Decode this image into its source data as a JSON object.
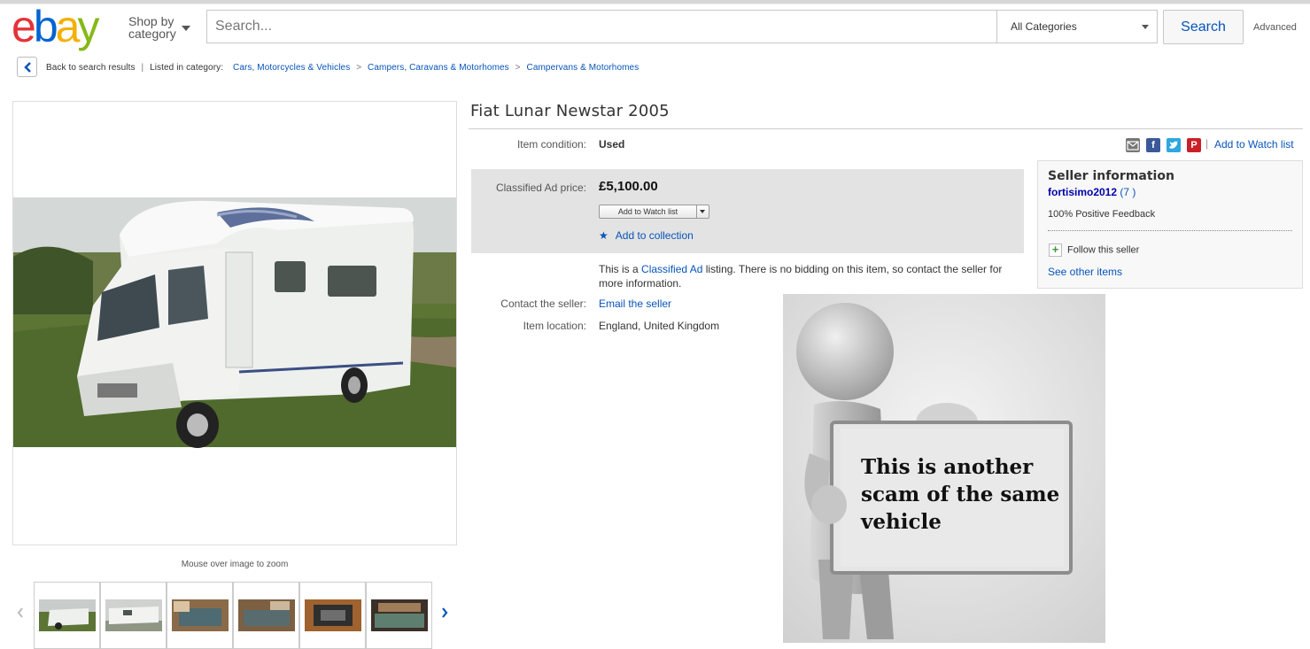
{
  "header": {
    "logo_letters": [
      "e",
      "b",
      "a",
      "y"
    ],
    "shop_by_line1": "Shop by",
    "shop_by_line2": "category",
    "search_placeholder": "Search...",
    "category_selected": "All Categories",
    "search_button": "Search",
    "advanced_link": "Advanced"
  },
  "breadcrumb": {
    "back_label": "Back to search results",
    "listed_in": "Listed in category:",
    "categories": [
      "Cars, Motorcycles & Vehicles",
      "Campers, Caravans & Motorhomes",
      "Campervans & Motorhomes"
    ]
  },
  "gallery": {
    "zoom_hint": "Mouse over image to zoom",
    "thumbnail_count": 6
  },
  "listing": {
    "title": "Fiat Lunar Newstar 2005",
    "condition_label": "Item condition:",
    "condition_value": "Used",
    "price_label": "Classified Ad price:",
    "price_value": "£5,100.00",
    "watch_button": "Add to Watch list",
    "collection_link": "Add to collection",
    "classified_text_before": "This is a",
    "classified_link": "Classified Ad",
    "classified_text_after": "listing. There is no bidding on this item, so contact the seller for more information.",
    "contact_label": "Contact the seller:",
    "contact_value": "Email the seller",
    "location_label": "Item location:",
    "location_value": "England, United Kingdom"
  },
  "share": {
    "icons": [
      "email-icon",
      "facebook-icon",
      "twitter-icon",
      "pinterest-icon"
    ],
    "watch_link": "Add to Watch list",
    "separator": "|"
  },
  "seller": {
    "heading": "Seller information",
    "username": "fortisimo2012",
    "feedback_score": "(7 )",
    "feedback_percent": "100% Positive Feedback",
    "follow_label": "Follow this seller",
    "other_items": "See other items"
  },
  "overlay": {
    "sign_text": "This is another scam of the same vehicle"
  },
  "colors": {
    "link": "#0654ba",
    "logo_e": "#e53238",
    "logo_b": "#0064d2",
    "logo_a": "#f5af02",
    "logo_y": "#86b817",
    "price_box": "#e3e3e3"
  }
}
